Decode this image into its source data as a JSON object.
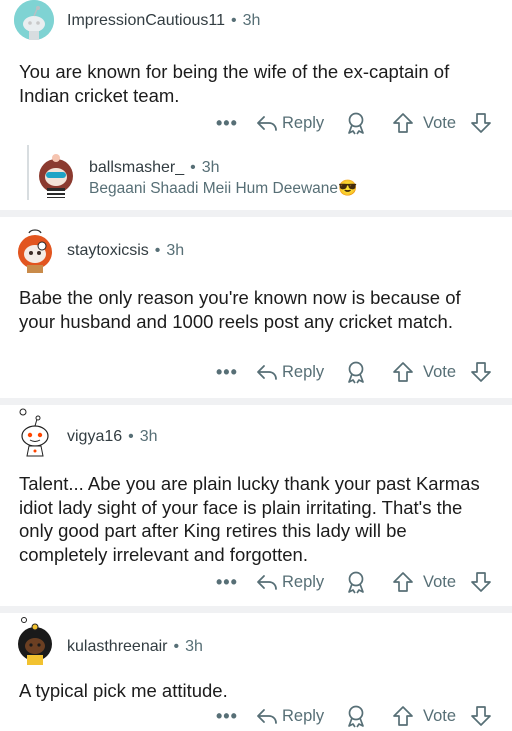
{
  "comments": [
    {
      "username": "ImpressionCautious11",
      "separator": "•",
      "time": "3h",
      "text": "You are known for being the wife of the ex-captain of Indian cricket team.",
      "actions": {
        "more": "•••",
        "reply": "Reply",
        "vote": "Vote"
      },
      "replies": [
        {
          "username": "ballsmasher_",
          "separator": "•",
          "time": "3h",
          "text": "Begaani Shaadi Meii Hum Deewane😎"
        }
      ]
    },
    {
      "username": "staytoxicsis",
      "separator": "•",
      "time": "3h",
      "text": "Babe the only reason you're known now is because of your husband and 1000 reels post any cricket match.",
      "actions": {
        "more": "•••",
        "reply": "Reply",
        "vote": "Vote"
      }
    },
    {
      "username": "vigya16",
      "separator": "•",
      "time": "3h",
      "text": "Talent... Abe you are plain lucky thank your past Karmas idiot lady sight of your face is plain irritating. That's the only good part after King retires this lady will be completely irrelevant and forgotten.",
      "actions": {
        "more": "•••",
        "reply": "Reply",
        "vote": "Vote"
      }
    },
    {
      "username": "kulasthreenair",
      "separator": "•",
      "time": "3h",
      "text": "A typical pick me attitude.",
      "actions": {
        "more": "•••",
        "reply": "Reply",
        "vote": "Vote"
      }
    }
  ],
  "icons": {
    "reply": "reply-arrow-icon",
    "award": "award-icon",
    "upvote": "upvote-arrow-icon",
    "downvote": "downvote-arrow-icon"
  },
  "colors": {
    "meta_text": "#576f76",
    "separator": "#f0f1f3",
    "avatar_teal": "#7fd3d3"
  }
}
